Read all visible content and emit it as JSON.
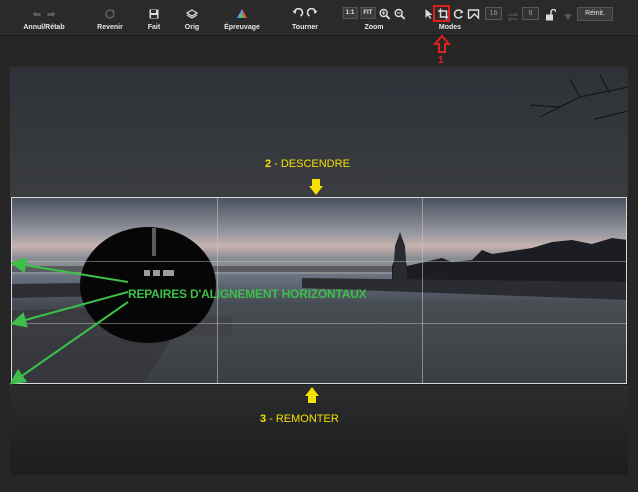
{
  "toolbar": {
    "undo_redo_label": "Annul/Rétab",
    "revert_label": "Revenir",
    "done_label": "Fait",
    "original_label": "Orig",
    "proof_label": "Épreuvage",
    "rotate_label": "Tourner",
    "zoom_label": "Zoom",
    "zoom_1to1": "1:1",
    "zoom_fit": "FIT",
    "modes_label": "Modes",
    "ratio_width": "16",
    "ratio_height": "9",
    "reset_label": "Réinit."
  },
  "annotations": {
    "step1_number": "1",
    "step2_number": "2",
    "step2_text": "- DESCENDRE",
    "step3_number": "3",
    "step3_text": "- REMONTER",
    "alignment_label": "REPAIRES D'ALIGNEMENT HORIZONTAUX"
  },
  "colors": {
    "highlight_red": "#e02020",
    "annotation_yellow": "#f5e000",
    "annotation_green": "#3dbf4a"
  },
  "icons": {
    "undo": "undo-icon",
    "redo": "redo-icon",
    "revert": "revert-icon",
    "done": "save-icon",
    "original": "layers-icon",
    "proof": "color-wheel-icon",
    "rotate_left": "rotate-left-icon",
    "rotate_right": "rotate-right-icon",
    "zoom_in": "zoom-in-icon",
    "zoom_out": "zoom-out-icon",
    "pointer": "pointer-icon",
    "crop": "crop-icon",
    "straighten": "straighten-icon",
    "perspective": "perspective-icon",
    "swap": "swap-icon",
    "lock": "lock-icon",
    "dropdown": "chevron-down-icon"
  }
}
